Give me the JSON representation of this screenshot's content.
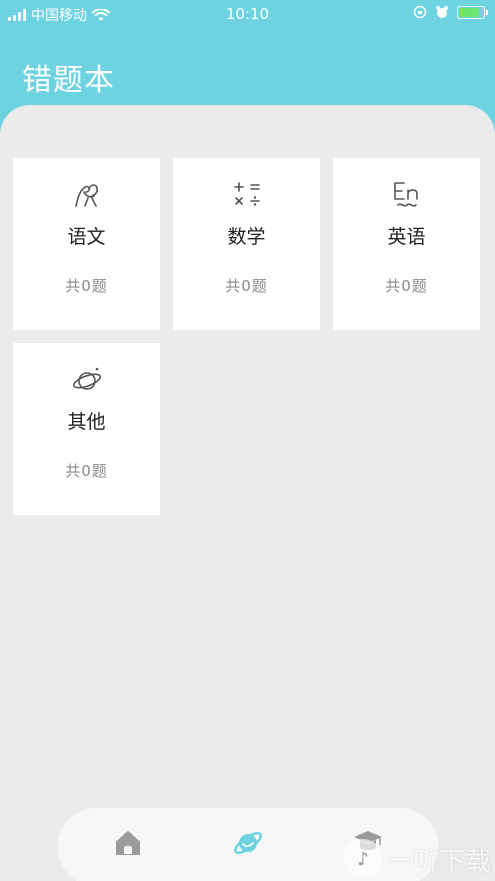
{
  "status_bar": {
    "carrier": "中国移动",
    "time": "10:10"
  },
  "header": {
    "title": "错题本"
  },
  "subjects": [
    {
      "name": "语文",
      "count": "共0题",
      "icon": "chinese-subject-icon"
    },
    {
      "name": "数学",
      "count": "共0题",
      "icon": "math-subject-icon"
    },
    {
      "name": "英语",
      "count": "共0题",
      "icon": "english-subject-icon"
    },
    {
      "name": "其他",
      "count": "共0题",
      "icon": "other-subject-icon"
    }
  ],
  "tabbar": {
    "items": [
      {
        "icon": "home-icon",
        "active": false
      },
      {
        "icon": "planet-icon",
        "active": true
      },
      {
        "icon": "graduation-cap-icon",
        "active": false
      }
    ],
    "active_color": "#6dd3e1",
    "inactive_color": "#9a9a9a"
  },
  "watermark": {
    "text": "一听下载"
  },
  "colors": {
    "header_bg": "#6dd3e1",
    "content_bg": "#ebebeb",
    "card_bg": "#ffffff"
  }
}
